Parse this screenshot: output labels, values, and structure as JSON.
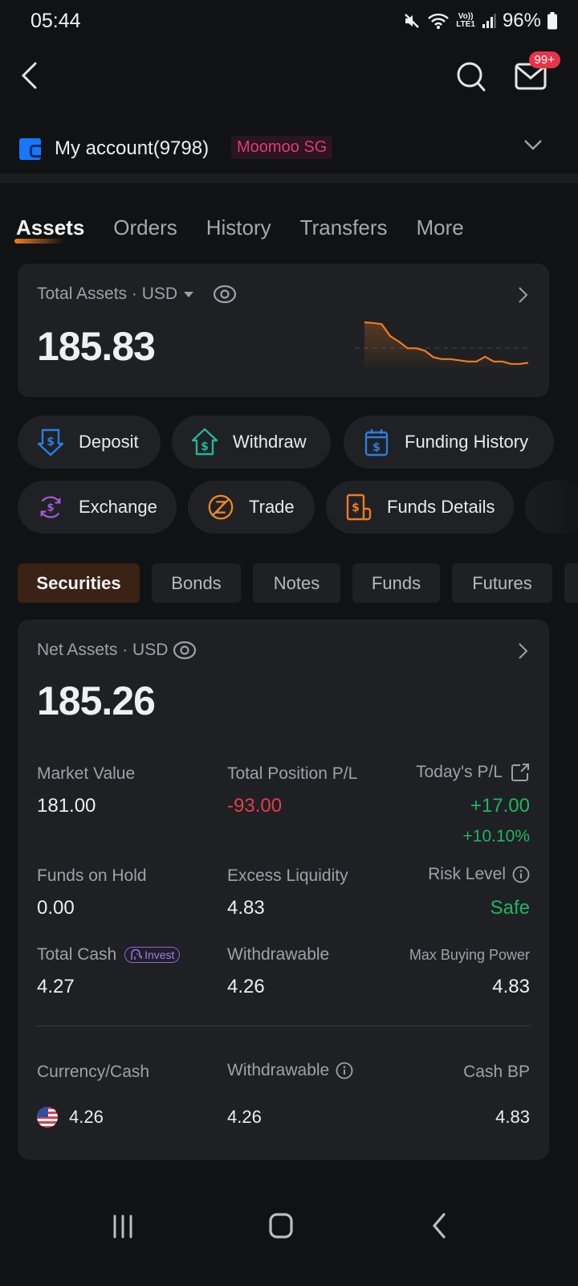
{
  "status_bar": {
    "time": "05:44",
    "network": "Vo)) LTE1",
    "battery": "96%"
  },
  "nav": {
    "message_badge": "99+"
  },
  "account": {
    "name": "My account(9798)",
    "broker_tag": "Moomoo SG"
  },
  "tabs": [
    {
      "label": "Assets",
      "active": true
    },
    {
      "label": "Orders",
      "active": false
    },
    {
      "label": "History",
      "active": false
    },
    {
      "label": "Transfers",
      "active": false
    },
    {
      "label": "More",
      "active": false
    }
  ],
  "total_assets": {
    "label": "Total Assets · USD",
    "value": "185.83",
    "sparkline": [
      96,
      95,
      93,
      73,
      64,
      53,
      53,
      49,
      38,
      35,
      35,
      33,
      31,
      31,
      39,
      31,
      31,
      27,
      27,
      29
    ]
  },
  "quick_actions": [
    {
      "label": "Deposit",
      "icon": "deposit-icon",
      "color": "#2a7de1"
    },
    {
      "label": "Withdraw",
      "icon": "withdraw-icon",
      "color": "#26b39a"
    },
    {
      "label": "Funding History",
      "icon": "funding-history-icon",
      "color": "#2a7de1"
    },
    {
      "label": "Exchange",
      "icon": "exchange-icon",
      "color": "#a45ad6"
    },
    {
      "label": "Trade",
      "icon": "trade-icon",
      "color": "#ef8a22"
    },
    {
      "label": "Funds Details",
      "icon": "funds-details-icon",
      "color": "#ef7a2a"
    }
  ],
  "segments": [
    {
      "label": "Securities",
      "active": true
    },
    {
      "label": "Bonds",
      "active": false
    },
    {
      "label": "Notes",
      "active": false
    },
    {
      "label": "Funds",
      "active": false
    },
    {
      "label": "Futures",
      "active": false
    }
  ],
  "net_assets": {
    "label": "Net Assets · USD",
    "value": "185.26",
    "market_value": {
      "label": "Market Value",
      "value": "181.00"
    },
    "total_position_pl": {
      "label": "Total Position P/L",
      "value": "-93.00"
    },
    "todays_pl": {
      "label": "Today's P/L",
      "value": "+17.00",
      "percent": "+10.10%"
    },
    "funds_on_hold": {
      "label": "Funds on Hold",
      "value": "0.00"
    },
    "excess_liquidity": {
      "label": "Excess Liquidity",
      "value": "4.83"
    },
    "risk_level": {
      "label": "Risk Level",
      "value": "Safe"
    },
    "total_cash": {
      "label": "Total Cash",
      "tag": "Invest",
      "value": "4.27"
    },
    "withdrawable": {
      "label": "Withdrawable",
      "value": "4.26"
    },
    "max_buying_power": {
      "label": "Max Buying Power",
      "value": "4.83"
    },
    "currency_table": {
      "headers": [
        "Currency/Cash",
        "Withdrawable",
        "Cash BP"
      ],
      "rows": [
        {
          "currency": "USD",
          "cash": "4.26",
          "withdrawable": "4.26",
          "cash_bp": "4.83"
        }
      ]
    }
  },
  "colors": {
    "accent": "#f07d1c",
    "loss": "#e0404c",
    "gain": "#1fb564",
    "brand": "#1677ff"
  }
}
